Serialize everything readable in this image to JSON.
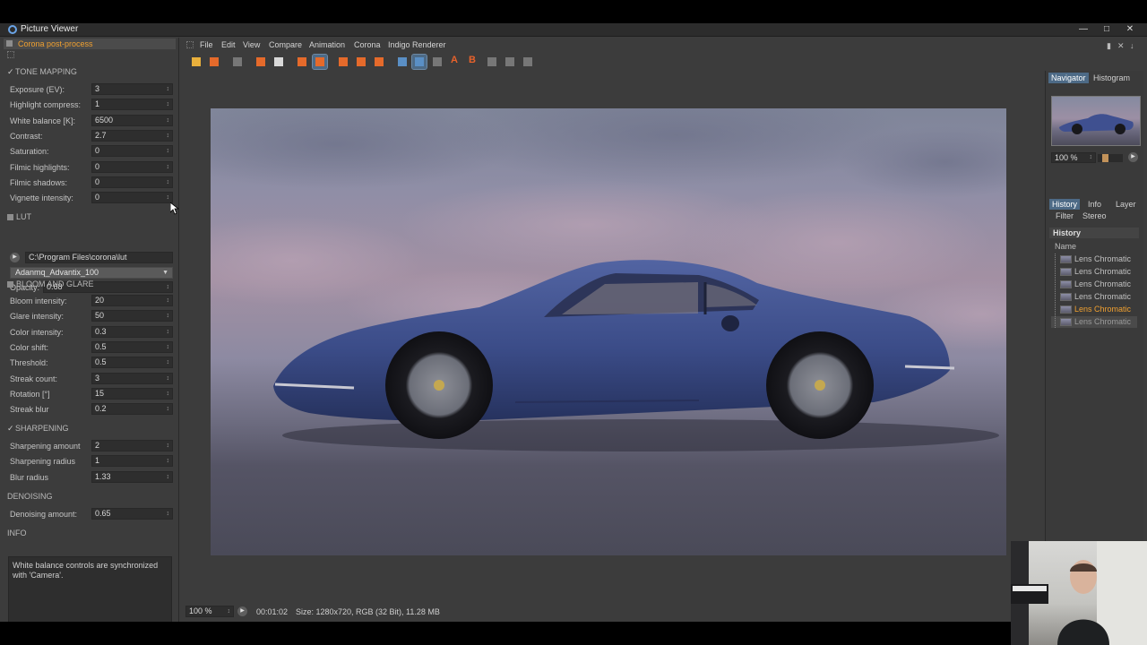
{
  "window": {
    "title": "Picture Viewer"
  },
  "left_panel": {
    "tab_label": "Corona post-process",
    "tone_mapping": {
      "header": "TONE MAPPING",
      "rows": [
        {
          "label": "Exposure (EV):",
          "value": "3"
        },
        {
          "label": "Highlight compress:",
          "value": "1"
        },
        {
          "label": "White balance [K]:",
          "value": "6500"
        },
        {
          "label": "Contrast:",
          "value": "2.7"
        },
        {
          "label": "Saturation:",
          "value": "0"
        },
        {
          "label": "Filmic highlights:",
          "value": "0"
        },
        {
          "label": "Filmic shadows:",
          "value": "0"
        },
        {
          "label": "Vignette intensity:",
          "value": "0"
        }
      ]
    },
    "lut": {
      "header": "LUT",
      "path": "C:\\Program Files\\corona\\lut",
      "selected": "Adanmq_Advantix_100",
      "opacity_label": "Opacity:",
      "opacity_value": "0.68"
    },
    "bloom_glare": {
      "header": "BLOOM AND GLARE",
      "rows": [
        {
          "label": "Bloom intensity:",
          "value": "20"
        },
        {
          "label": "Glare intensity:",
          "value": "50"
        },
        {
          "label": "Color intensity:",
          "value": "0.3"
        },
        {
          "label": "Color shift:",
          "value": "0.5"
        },
        {
          "label": "Threshold:",
          "value": "0.5"
        },
        {
          "label": "Streak count:",
          "value": "3"
        },
        {
          "label": "Rotation [°]",
          "value": "15"
        },
        {
          "label": "Streak blur",
          "value": "0.2"
        }
      ]
    },
    "sharpening": {
      "header": "SHARPENING",
      "rows": [
        {
          "label": "Sharpening amount",
          "value": "2"
        },
        {
          "label": "Sharpening radius",
          "value": "1"
        },
        {
          "label": "Blur radius",
          "value": "1.33"
        }
      ]
    },
    "denoising": {
      "header": "DENOISING",
      "rows": [
        {
          "label": "Denoising amount:",
          "value": "0.65"
        }
      ]
    },
    "info": {
      "header": "INFO",
      "text": "White balance controls are synchronized with 'Camera'."
    }
  },
  "menu": [
    "File",
    "Edit",
    "View",
    "Compare",
    "Animation",
    "Corona",
    "Indigo Renderer"
  ],
  "status": {
    "zoom": "100 %",
    "time": "00:01:02",
    "size": "Size: 1280x720, RGB (32 Bit), 11.28 MB"
  },
  "right_panel": {
    "tabs_top": [
      {
        "label": "Navigator",
        "active": true
      },
      {
        "label": "Histogram",
        "active": false
      }
    ],
    "nav_zoom": "100 %",
    "nav_zoom_level": 0.25,
    "tabs_mid_row1": [
      {
        "label": "History",
        "active": true
      },
      {
        "label": "Info",
        "active": false
      },
      {
        "label": "Layer",
        "active": false
      }
    ],
    "tabs_mid_row2": [
      {
        "label": "Filter",
        "active": false
      },
      {
        "label": "Stereo",
        "active": false
      }
    ],
    "history_title": "History",
    "history_column": "Name",
    "history_items": [
      {
        "label": "Lens Chromatic"
      },
      {
        "label": "Lens Chromatic"
      },
      {
        "label": "Lens Chromatic"
      },
      {
        "label": "Lens Chromatic"
      },
      {
        "label": "Lens Chromatic"
      },
      {
        "label": "Lens Chromatic"
      }
    ]
  },
  "colors": {
    "accent_orange": "#f0a030",
    "panel_bg": "#3c3c3c",
    "field_bg": "#2e2e2e",
    "selected_tab": "#4d6a86",
    "car_blue": "#3d4f8a"
  }
}
